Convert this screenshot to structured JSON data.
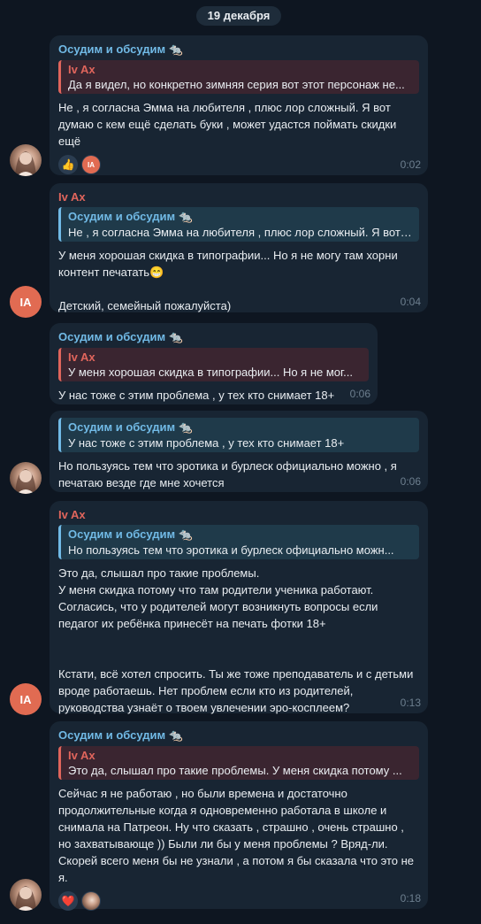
{
  "date_label": "19 декабря",
  "messages": [
    {
      "sender": "Осудим и обсудим 🐀",
      "quote_name": "Iv Ax",
      "quote_text": "Да я видел, но конкретно зимняя серия вот этот персонаж не...",
      "text": "Не , я согласна Эмма на любителя , плюс лор сложный. Я вот думаю с кем ещё сделать буки , может удастся поймать скидки ещё",
      "time": "0:02",
      "reactions": [
        "👍",
        "IA"
      ]
    },
    {
      "sender": "Iv Ax",
      "quote_name": "Осудим и обсудим 🐀",
      "quote_text": "Не , я согласна Эмма на любителя , плюс лор сложный. Я вот ...",
      "text": "У меня хорошая скидка в типографии... Но я не могу там хорни контент печатать😁\n\nДетский, семейный пожалуйста)",
      "time": "0:04",
      "avatar_initials": "IA"
    },
    {
      "sender": "Осудим и обсудим 🐀",
      "quote_name": "Iv Ax",
      "quote_text": "У меня хорошая скидка в типографии... Но я не мог...",
      "text": "У нас тоже с этим проблема , у тех кто снимает 18+",
      "time": "0:06"
    },
    {
      "quote_name": "Осудим и обсудим 🐀",
      "quote_text": "У нас тоже с этим проблема , у тех кто снимает 18+",
      "text": "Но пользуясь тем что эротика и бурлеск официально можно , я печатаю везде где мне хочется",
      "time": "0:06"
    },
    {
      "sender": "Iv Ax",
      "quote_name": "Осудим и обсудим 🐀",
      "quote_text": "Но пользуясь тем что эротика и бурлеск официально можн...",
      "text": "Это да, слышал про такие проблемы.\nУ меня скидка потому что там родители ученика работают.\nСогласись, что у родителей могут возникнуть вопросы если педагог их ребёнка принесёт на печать фотки 18+\n\n\nКстати, всё хотел спросить. Ты же тоже преподаватель и с детьми вроде работаешь. Нет проблем если кто из родителей, руководства узнаёт о твоем увлечении эро-косплеем?",
      "time": "0:13",
      "avatar_initials": "IA"
    },
    {
      "sender": "Осудим и обсудим 🐀",
      "quote_name": "Iv Ax",
      "quote_text": "Это да, слышал про такие проблемы.  У меня скидка потому ...",
      "text": "Сейчас я не работаю , но были времена и достаточно продолжительные когда я одновременно работала в школе и снимала на Патреон. Ну что сказать , страшно , очень страшно , но захватывающе )) Были ли бы у меня проблемы ? Вряд-ли. Скорей всего меня бы не узнали , а потом я бы сказала что это не я.",
      "time": "0:18",
      "reactions": [
        "❤️",
        "avatar"
      ]
    }
  ]
}
